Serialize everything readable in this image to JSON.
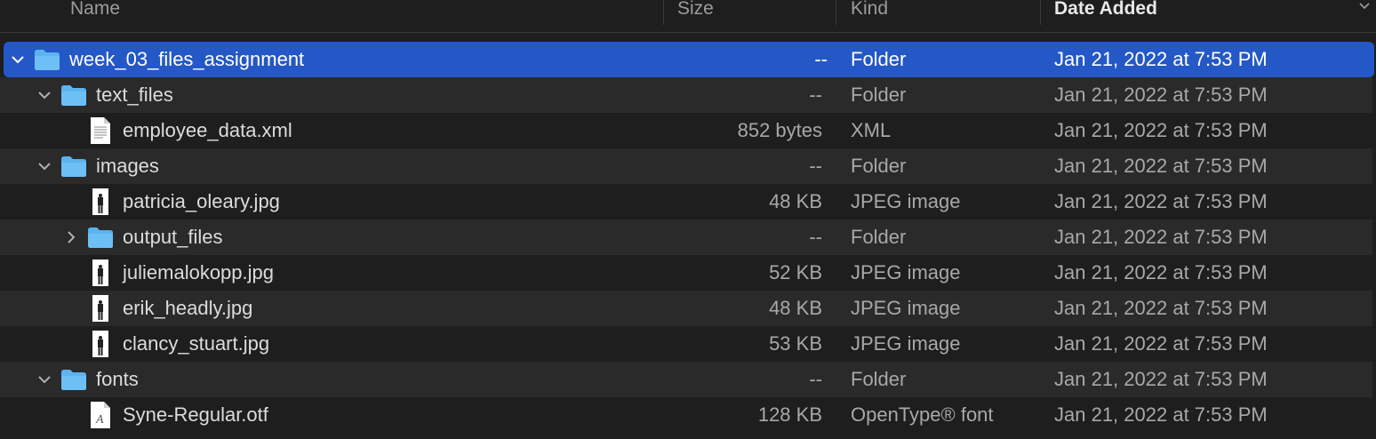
{
  "columns": {
    "name": "Name",
    "size": "Size",
    "kind": "Kind",
    "date_added": "Date Added"
  },
  "sort_icon": "chevron-down-icon",
  "colors": {
    "selection": "#2458c6",
    "folder": "#5bb3f0",
    "background": "#1e1e1e",
    "alt_row": "#2a2a2a"
  },
  "rows": [
    {
      "name": "week_03_files_assignment",
      "size": "--",
      "kind": "Folder",
      "date": "Jan 21, 2022 at 7:53 PM",
      "type": "folder",
      "disclosure": "expanded",
      "selected": true
    },
    {
      "name": "text_files",
      "size": "--",
      "kind": "Folder",
      "date": "Jan 21, 2022 at 7:53 PM",
      "type": "folder",
      "disclosure": "expanded"
    },
    {
      "name": "employee_data.xml",
      "size": "852 bytes",
      "kind": "XML",
      "date": "Jan 21, 2022 at 7:53 PM",
      "type": "xml"
    },
    {
      "name": "images",
      "size": "--",
      "kind": "Folder",
      "date": "Jan 21, 2022 at 7:53 PM",
      "type": "folder",
      "disclosure": "expanded"
    },
    {
      "name": "patricia_oleary.jpg",
      "size": "48 KB",
      "kind": "JPEG image",
      "date": "Jan 21, 2022 at 7:53 PM",
      "type": "image"
    },
    {
      "name": "output_files",
      "size": "--",
      "kind": "Folder",
      "date": "Jan 21, 2022 at 7:53 PM",
      "type": "folder",
      "disclosure": "collapsed"
    },
    {
      "name": "juliemalokopp.jpg",
      "size": "52 KB",
      "kind": "JPEG image",
      "date": "Jan 21, 2022 at 7:53 PM",
      "type": "image"
    },
    {
      "name": "erik_headly.jpg",
      "size": "48 KB",
      "kind": "JPEG image",
      "date": "Jan 21, 2022 at 7:53 PM",
      "type": "image"
    },
    {
      "name": "clancy_stuart.jpg",
      "size": "53 KB",
      "kind": "JPEG image",
      "date": "Jan 21, 2022 at 7:53 PM",
      "type": "image"
    },
    {
      "name": "fonts",
      "size": "--",
      "kind": "Folder",
      "date": "Jan 21, 2022 at 7:53 PM",
      "type": "folder",
      "disclosure": "expanded"
    },
    {
      "name": "Syne-Regular.otf",
      "size": "128 KB",
      "kind": "OpenType® font",
      "date": "Jan 21, 2022 at 7:53 PM",
      "type": "font"
    }
  ]
}
